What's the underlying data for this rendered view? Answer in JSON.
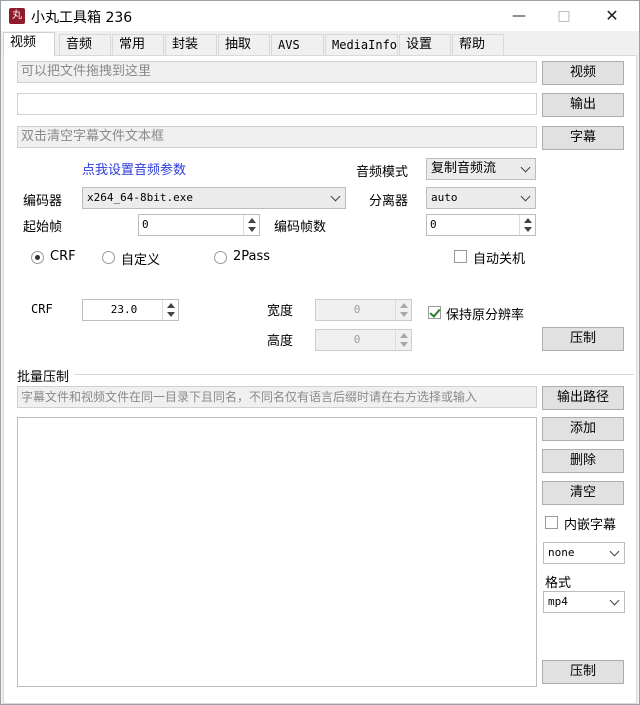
{
  "window": {
    "title": "小丸工具箱 236"
  },
  "tabs": [
    "视频",
    "音频",
    "常用",
    "封装",
    "抽取",
    "AVS",
    "MediaInfo",
    "设置",
    "帮助"
  ],
  "video": {
    "video_drop_placeholder": "可以把文件拖拽到这里",
    "output_value": "",
    "subtitle_placeholder": "双击清空字幕文件文本框",
    "video_btn": "视频",
    "output_btn": "输出",
    "subtitle_btn": "字幕",
    "audio_params_link": "点我设置音频参数",
    "audio_mode_label": "音频模式",
    "audio_mode_value": "复制音频流",
    "encoder_label": "编码器",
    "encoder_value": "x264_64-8bit.exe",
    "splitter_label": "分离器",
    "splitter_value": "auto",
    "start_frame_label": "起始帧",
    "start_frame_value": "0",
    "encode_frames_label": "编码帧数",
    "encode_frames_value": "0",
    "mode_crf": "CRF",
    "mode_custom": "自定义",
    "mode_2pass": "2Pass",
    "auto_shutdown": "自动关机",
    "crf_label": "CRF",
    "crf_value": "23.0",
    "width_label": "宽度",
    "width_value": "0",
    "height_label": "高度",
    "height_value": "0",
    "keep_resolution": "保持原分辨率",
    "compress_btn": "压制"
  },
  "batch": {
    "group_title": "批量压制",
    "hint_placeholder": "字幕文件和视频文件在同一目录下且同名，不同名仅有语言后缀时请在右方选择或输入",
    "output_path_btn": "输出路径",
    "add_btn": "添加",
    "delete_btn": "删除",
    "clear_btn": "清空",
    "embed_subtitle": "内嵌字幕",
    "subtitle_lang_value": "none",
    "format_label": "格式",
    "format_value": "mp4",
    "compress_btn": "压制"
  }
}
